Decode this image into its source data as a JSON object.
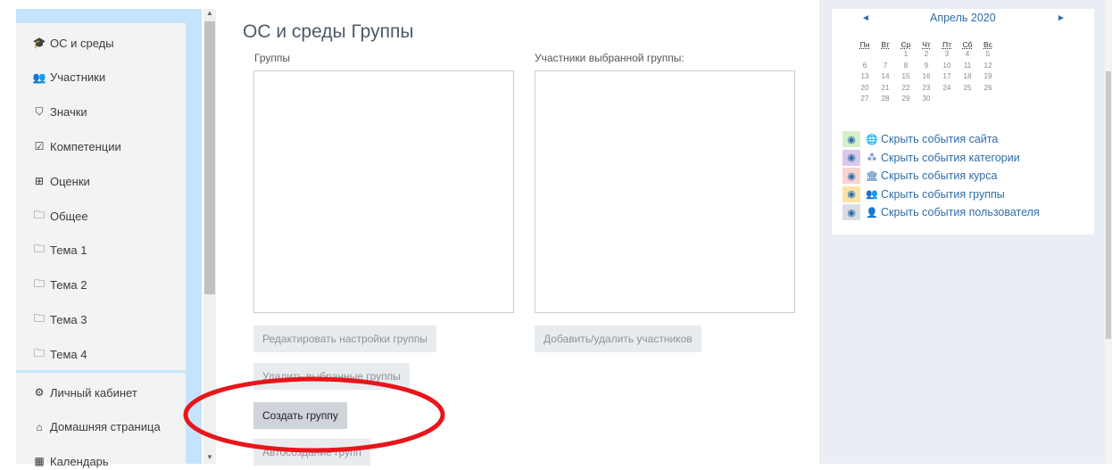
{
  "sidebar": {
    "course_items": [
      {
        "icon": "graduation-cap-icon",
        "glyph": "🎓",
        "label": "ОС и среды"
      },
      {
        "icon": "users-icon",
        "glyph": "👥",
        "label": "Участники"
      },
      {
        "icon": "shield-icon",
        "glyph": "⛉",
        "label": "Значки"
      },
      {
        "icon": "checkbox-icon",
        "glyph": "☑",
        "label": "Компетенции"
      },
      {
        "icon": "table-icon",
        "glyph": "⊞",
        "label": "Оценки"
      },
      {
        "icon": "folder-icon",
        "glyph": "🗀",
        "label": "Общее"
      },
      {
        "icon": "folder-icon",
        "glyph": "🗀",
        "label": "Тема 1"
      },
      {
        "icon": "folder-icon",
        "glyph": "🗀",
        "label": "Тема 2"
      },
      {
        "icon": "folder-icon",
        "glyph": "🗀",
        "label": "Тема 3"
      },
      {
        "icon": "folder-icon",
        "glyph": "🗀",
        "label": "Тема 4"
      }
    ],
    "site_items": [
      {
        "icon": "dashboard-icon",
        "glyph": "⚙",
        "label": "Личный кабинет"
      },
      {
        "icon": "home-icon",
        "glyph": "⌂",
        "label": "Домашняя страница"
      },
      {
        "icon": "calendar-icon",
        "glyph": "▦",
        "label": "Календарь"
      }
    ]
  },
  "main": {
    "title": "ОС и среды Группы",
    "groups_label": "Группы",
    "members_label": "Участники выбранной группы:",
    "buttons": {
      "edit_group": "Редактировать настройки группы",
      "add_remove_members": "Добавить/удалить участников",
      "delete_groups": "Удалить выбранные группы",
      "create_group": "Создать группу",
      "auto_create": "Автосоздание групп"
    }
  },
  "calendar": {
    "month": "Апрель 2020",
    "prev": "◄",
    "next": "►",
    "weekdays": [
      "Пн",
      "Вт",
      "Ср",
      "Чт",
      "Пт",
      "Сб",
      "Вс"
    ],
    "weeks": [
      [
        "",
        "",
        "1",
        "2",
        "3",
        "4",
        "5"
      ],
      [
        "6",
        "7",
        "8",
        "9",
        "10",
        "11",
        "12"
      ],
      [
        "13",
        "14",
        "15",
        "16",
        "17",
        "18",
        "19"
      ],
      [
        "20",
        "21",
        "22",
        "23",
        "24",
        "25",
        "26"
      ],
      [
        "27",
        "28",
        "29",
        "30",
        "",
        "",
        ""
      ]
    ],
    "legend": [
      {
        "icon": "globe-icon",
        "glyph": "🌐",
        "label": "Скрыть события сайта",
        "color": "#d6f0c8"
      },
      {
        "icon": "cubes-icon",
        "glyph": "⁂",
        "label": "Скрыть события категории",
        "color": "#d9c9ea"
      },
      {
        "icon": "university-icon",
        "glyph": "🏛",
        "label": "Скрыть события курса",
        "color": "#f9d3cf"
      },
      {
        "icon": "users-icon",
        "glyph": "👥",
        "label": "Скрыть события группы",
        "color": "#fbe3a8"
      },
      {
        "icon": "user-icon",
        "glyph": "👤",
        "label": "Скрыть события пользователя",
        "color": "#d9dee5"
      }
    ]
  },
  "annotation": {
    "color": "#e8151b"
  }
}
